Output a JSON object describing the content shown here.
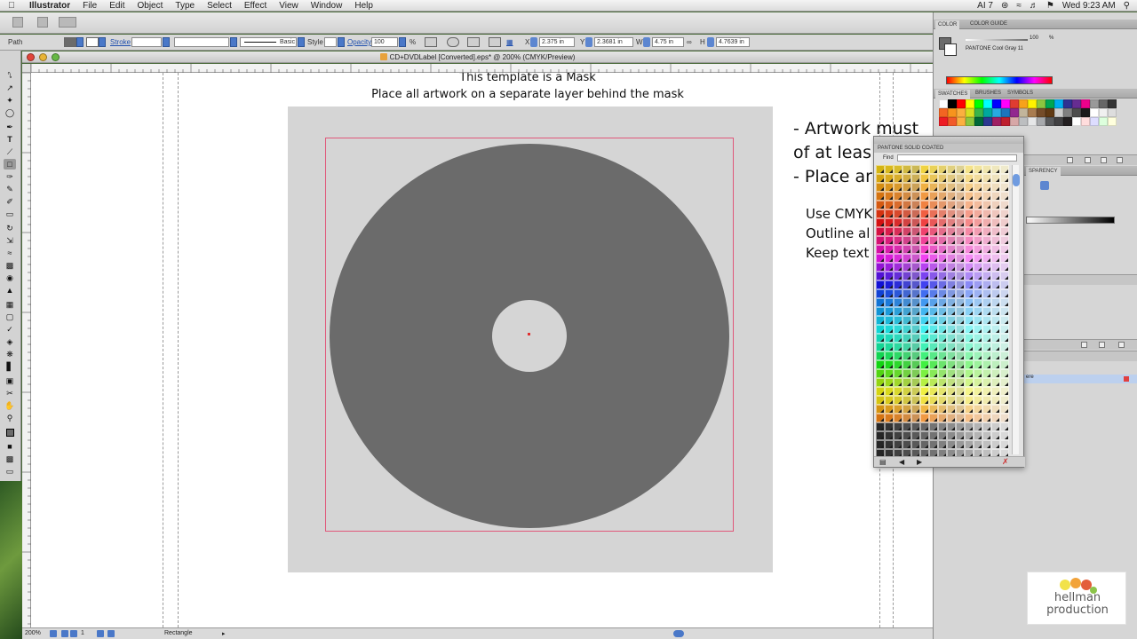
{
  "menubar": {
    "app_name": "Illustrator",
    "items": [
      "File",
      "Edit",
      "Object",
      "Type",
      "Select",
      "Effect",
      "View",
      "Window",
      "Help"
    ],
    "status_right": [
      "AI 7",
      "Wed 9:23 AM"
    ]
  },
  "controlbar": {
    "object_label": "Path",
    "stroke_label": "Stroke",
    "brush_label": "Basic",
    "style_label": "Style",
    "opacity_label": "Opacity",
    "opacity_value": "100",
    "opacity_unit": "%",
    "x_label": "X",
    "x_value": "2.375 in",
    "y_label": "Y",
    "y_value": "2.3681 in",
    "w_label": "W",
    "w_value": "4.75 in",
    "h_label": "H",
    "h_value": "4.7639 in"
  },
  "document": {
    "title": "CD+DVDLabel [Converted].eps* @ 200% (CMYK/Preview)"
  },
  "canvas": {
    "mask_title_line1": "This template is a Mask",
    "mask_title_line2": "Place all artwork on a separate layer behind the mask",
    "side_lines_large": [
      "- Artwork must",
      "of at leas",
      "- Place ar"
    ],
    "side_lines_small": [
      "Use CMYK",
      "Outline al",
      "Keep text"
    ]
  },
  "statusbar": {
    "zoom": "200%",
    "page": "1",
    "tool": "Rectangle"
  },
  "panels": {
    "color_tabs": [
      "COLOR",
      "COLOR GUIDE"
    ],
    "color_swatch_name": "PANTONE Cool Gray 11",
    "color_slider_value": "100",
    "color_slider_unit": "%",
    "swatch_tabs": [
      "SWATCHES",
      "BRUSHES",
      "SYMBOLS"
    ],
    "transparency_tab": "SPARENCY",
    "layer_name": "ere",
    "pantone_title": "PANTONE SOLID COATED",
    "pantone_find_label": "Find"
  },
  "watermark": {
    "line1": "hellman",
    "line2": "production"
  }
}
